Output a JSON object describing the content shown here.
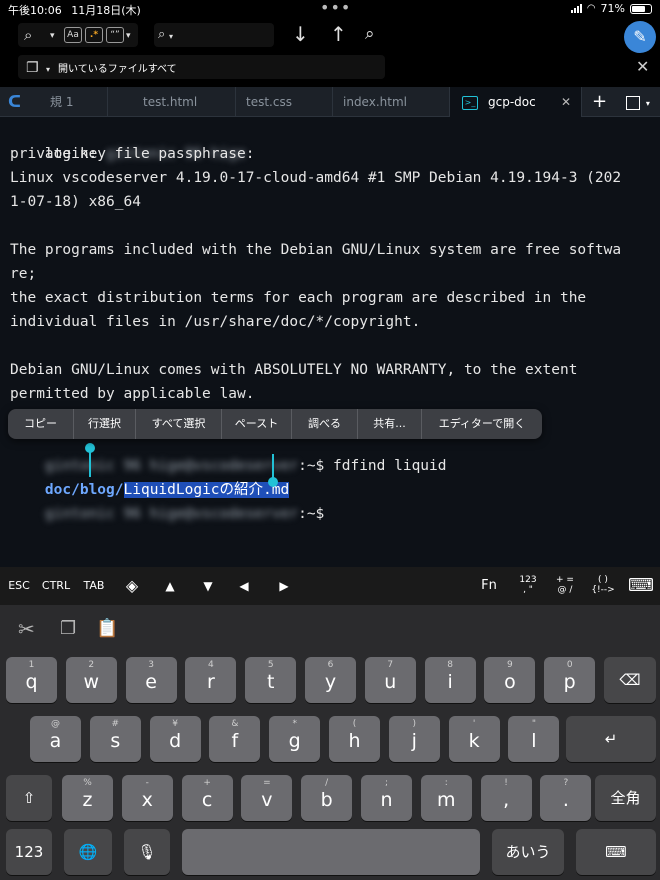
{
  "status_bar": {
    "time": "午後10:06",
    "date": "11月18日(木)",
    "battery": "71%"
  },
  "search_bar": {
    "case_option": "Aa",
    "regex_option": ".*",
    "word_option": "\"\"",
    "scope": "開いているファイルすべて"
  },
  "icons": {
    "search_options": "magnifier-folder-icon",
    "search": "search-icon",
    "down": "arrow-down-icon",
    "up": "arrow-up-icon",
    "replace": "replace-icon",
    "compose": "compose-icon",
    "close": "close-icon",
    "scope": "documents-icon",
    "app": "app-logo-icon",
    "terminal": "terminal-icon"
  },
  "tabs": [
    {
      "label": "規 1"
    },
    {
      "label": "test.html"
    },
    {
      "label": "test.css"
    },
    {
      "label": "index.html"
    },
    {
      "label": "gcp-doc"
    }
  ],
  "terminal": {
    "lines": [
      "login:",
      "private key file passphrase:",
      "Linux vscodeserver 4.19.0-17-cloud-amd64 #1 SMP Debian 4.19.194-3 (202",
      "1-07-18) x86_64",
      "",
      "The programs included with the Debian GNU/Linux system are free softwa",
      "re;",
      "the exact distribution terms for each program are described in the",
      "individual files in /usr/share/doc/*/copyright.",
      "",
      "Debian GNU/Linux comes with ABSOLUTELY NO WARRANTY, to the extent",
      "permitted by applicable law."
    ],
    "blurred_login": "gintonic 96 hige",
    "blurred_prompt": "gintonic 96 hige@vscodeserver",
    "command_tail": ":~$ fdfind liquid",
    "result_path": "doc/blog/",
    "result_selected": "LiquidLogicの紹介.md",
    "prompt_tail": ":~$"
  },
  "context_menu": [
    "コピー",
    "行選択",
    "すべて選択",
    "ペースト",
    "調べる",
    "共有...",
    "エディターで開く"
  ],
  "accessory_bar": {
    "esc": "ESC",
    "ctrl": "CTRL",
    "tab": "TAB",
    "arrow_pad": "◈",
    "up": "▲",
    "down": "▼",
    "left": "◀",
    "right": "▶",
    "fn": "Fn",
    "numbers": "123\n, \"",
    "symbols": "+ =\n@ /",
    "brackets": "( )\n{!-->"
  },
  "shortcut_icons": {
    "cut": "scissors-icon",
    "copy": "copy-icon",
    "paste": "paste-icon"
  },
  "keyboard": {
    "row1": [
      {
        "sub": "1",
        "main": "q"
      },
      {
        "sub": "2",
        "main": "w"
      },
      {
        "sub": "3",
        "main": "e"
      },
      {
        "sub": "4",
        "main": "r"
      },
      {
        "sub": "5",
        "main": "t"
      },
      {
        "sub": "6",
        "main": "y"
      },
      {
        "sub": "7",
        "main": "u"
      },
      {
        "sub": "8",
        "main": "i"
      },
      {
        "sub": "9",
        "main": "o"
      },
      {
        "sub": "0",
        "main": "p"
      }
    ],
    "row2": [
      {
        "sub": "@",
        "main": "a"
      },
      {
        "sub": "#",
        "main": "s"
      },
      {
        "sub": "¥",
        "main": "d"
      },
      {
        "sub": "&",
        "main": "f"
      },
      {
        "sub": "*",
        "main": "g"
      },
      {
        "sub": "(",
        "main": "h"
      },
      {
        "sub": ")",
        "main": "j"
      },
      {
        "sub": "'",
        "main": "k"
      },
      {
        "sub": "\"",
        "main": "l"
      }
    ],
    "row3": [
      {
        "sub": "%",
        "main": "z"
      },
      {
        "sub": "-",
        "main": "x"
      },
      {
        "sub": "+",
        "main": "c"
      },
      {
        "sub": "=",
        "main": "v"
      },
      {
        "sub": "/",
        "main": "b"
      },
      {
        "sub": ";",
        "main": "n"
      },
      {
        "sub": ":",
        "main": "m"
      },
      {
        "sub": "!",
        "main": ","
      },
      {
        "sub": "?",
        "main": "."
      }
    ],
    "backspace": "⌫",
    "return": "↵",
    "shift": "⇧",
    "kanji": "全角",
    "numbers": "123",
    "globe": "🌐",
    "mic": "🎙",
    "space": "",
    "kana": "あいう",
    "hide": "⌨"
  }
}
